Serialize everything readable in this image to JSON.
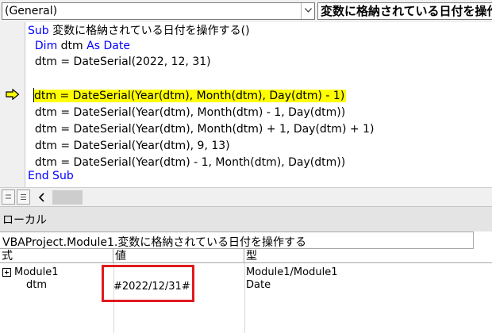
{
  "colors": {
    "keyword": "#0000ff",
    "highlight": "#ffff00",
    "annotation": "#e0191f",
    "panel": "#f0f0f0"
  },
  "toolbar": {
    "object_combo": "(General)",
    "procedure_combo": "変数に格納されている日付を操作"
  },
  "code": {
    "line1_kw_sub": "Sub",
    "line1_rest": " 変数に格納されている日付を操作する()",
    "line2_indent": "  ",
    "line2_kw_dim": "Dim",
    "line2_mid": " dtm ",
    "line2_kw_as": "As",
    "line2_sp": " ",
    "line2_kw_date": "Date",
    "line3": "  dtm = DateSerial(2022, 12, 31)",
    "line5": "dtm = DateSerial(Year(dtm), Month(dtm), Day(dtm) - 1)",
    "line6": "  dtm = DateSerial(Year(dtm), Month(dtm) - 1, Day(dtm))",
    "line7": "  dtm = DateSerial(Year(dtm), Month(dtm) + 1, Day(dtm) + 1)",
    "line8": "  dtm = DateSerial(Year(dtm), 9, 13)",
    "line9": "  dtm = DateSerial(Year(dtm) - 1, Month(dtm), Day(dtm))",
    "line10_kw": "End Sub",
    "current_line_indicator": "arrow-icon"
  },
  "locals": {
    "title": "ローカル",
    "context": "VBAProject.Module1.変数に格納されている日付を操作する",
    "columns": {
      "expression": "式",
      "value": "値",
      "type": "型"
    },
    "rows": [
      {
        "expression": "Module1",
        "value": "",
        "type": "Module1/Module1"
      },
      {
        "expression": "dtm",
        "value": "#2022/12/31#",
        "type": "Date"
      }
    ]
  }
}
